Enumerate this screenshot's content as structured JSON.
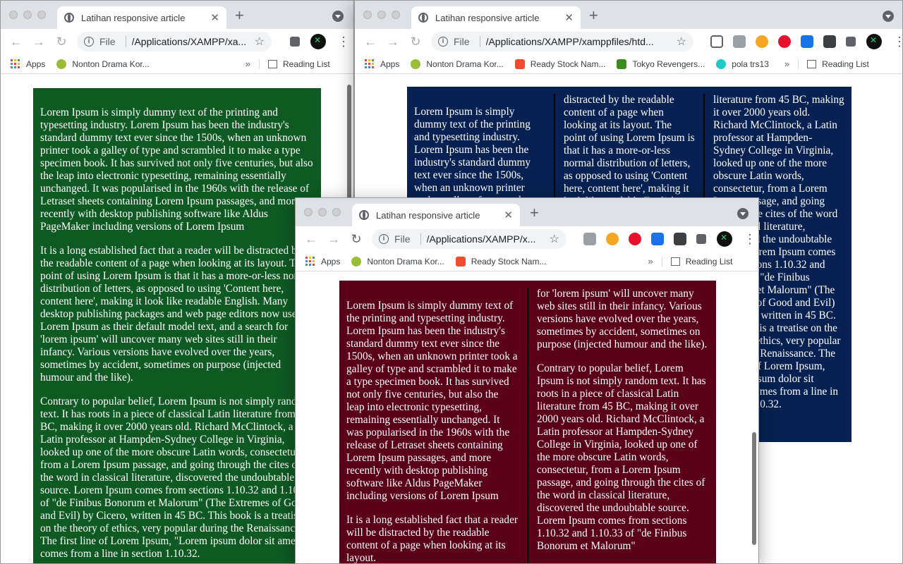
{
  "browser": {
    "tab_title": "Latihan responsive article",
    "new_tab": "+",
    "close": "✕",
    "file_label": "File",
    "back": "←",
    "forward": "→",
    "reload": "↻",
    "star": "☆",
    "info": "i",
    "menu": "⋮",
    "chevron": "»",
    "apps": "Apps",
    "reading_list": "Reading List"
  },
  "windows": {
    "back_left": {
      "url": "/Applications/XAMPP/xa...",
      "bookmarks": [
        "Nonton Drama Kor..."
      ],
      "accent": "#0f5a23"
    },
    "back_right": {
      "url": "/Applications/XAMPP/xamppfiles/htd...",
      "bookmarks": [
        "Nonton Drama Kor...",
        "Ready Stock Nam...",
        "Tokyo Revengers...",
        "pola trs13"
      ],
      "accent": "#072252"
    },
    "front": {
      "url": "/Applications/XAMPP/x...",
      "bookmarks": [
        "Nonton Drama Kor...",
        "Ready Stock Nam..."
      ],
      "accent": "#5a0018"
    }
  },
  "article": {
    "p1": "Lorem Ipsum is simply dummy text of the printing and typesetting industry. Lorem Ipsum has been the industry's standard dummy text ever since the 1500s, when an unknown printer took a galley of type and scrambled it to make a type specimen book. It has survived not only five centuries, but also the leap into electronic typesetting, remaining essentially unchanged. It was popularised in the 1960s with the release of Letraset sheets containing Lorem Ipsum passages, and more recently with desktop publishing software like Aldus PageMaker including versions of Lorem Ipsum",
    "p2": "It is a long established fact that a reader will be distracted by the readable content of a page when looking at its layout. The point of using Lorem Ipsum is that it has a more-or-less normal distribution of letters, as opposed to using 'Content here, content here', making it look like readable English. Many desktop publishing packages and web page editors now use Lorem Ipsum as their default model text, and a search for 'lorem ipsum' will uncover many web sites still in their infancy. Various versions have evolved over the years, sometimes by accident, sometimes on purpose (injected humour and the like).",
    "p3": "Contrary to popular belief, Lorem Ipsum is not simply random text. It has roots in a piece of classical Latin literature from 45 BC, making it over 2000 years old. Richard McClintock, a Latin professor at Hampden-Sydney College in Virginia, looked up one of the more obscure Latin words, consectetur, from a Lorem Ipsum passage, and going through the cites of the word in classical literature, discovered the undoubtable source. Lorem Ipsum comes from sections 1.10.32 and 1.10.33 of \"de Finibus Bonorum et Malorum\" (The Extremes of Good and Evil) by Cicero, written in 45 BC. This book is a treatise on the theory of ethics, very popular during the Renaissance. The first line of Lorem Ipsum, \"Lorem ipsum dolor sit amet..\", comes from a line in section 1.10.32."
  },
  "right_window_columns": {
    "col1": "Lorem Ipsum is simply dummy text of the printing and typesetting industry. Lorem Ipsum has been the industry's standard dummy text ever since the 1500s, when an unknown printer took a galley of type and scrambled it to make a type specimen book.",
    "col2": "distracted by the readable content of a page when looking at its layout. The point of using Lorem Ipsum is that it has a more-or-less normal distribution of letters, as opposed to using 'Content here, content here', making it look like readable English.",
    "col3": "literature from 45 BC, making it over 2000 years old. Richard McClintock, a Latin professor at Hampden-Sydney College in Virginia, looked up one of the more obscure Latin words, consectetur, from a Lorem Ipsum passage, and going through the cites of the word in classical literature, discovered the undoubtable source. Lorem Ipsum comes from sections 1.10.32 and 1.10.33 of \"de Finibus Bonorum et Malorum\" (The Extremes of Good and Evil) by Cicero, written in 45 BC. This book is a treatise on the theory of ethics, very popular during the Renaissance. The first line of Lorem Ipsum, \"Lorem ipsum dolor sit amet..\", comes from a line in section 1.10.32."
  },
  "front_window_columns": {
    "col1_p1": "Lorem Ipsum is simply dummy text of the printing and typesetting industry. Lorem Ipsum has been the industry's standard dummy text ever since the 1500s, when an unknown printer took a galley of type and scrambled it to make a type specimen book. It has survived not only five centuries, but also the leap into electronic typesetting, remaining essentially unchanged. It was popularised in the 1960s with the release of Letraset sheets containing Lorem Ipsum passages, and more recently with desktop publishing software like Aldus PageMaker including versions of Lorem Ipsum",
    "col1_p2": "It is a long established fact that a reader will be distracted by the readable content of a page when looking at its layout.",
    "col2_p1": "for 'lorem ipsum' will uncover many web sites still in their infancy. Various versions have evolved over the years, sometimes by accident, sometimes on purpose (injected humour and the like).",
    "col2_p2": "Contrary to popular belief, Lorem Ipsum is not simply random text. It has roots in a piece of classical Latin literature from 45 BC, making it over 2000 years old. Richard McClintock, a Latin professor at Hampden-Sydney College in Virginia, looked up one of the more obscure Latin words, consectetur, from a Lorem Ipsum passage, and going through the cites of the word in classical literature, discovered the undoubtable source. Lorem Ipsum comes from sections 1.10.32 and 1.10.33 of \"de Finibus Bonorum et Malorum\""
  }
}
